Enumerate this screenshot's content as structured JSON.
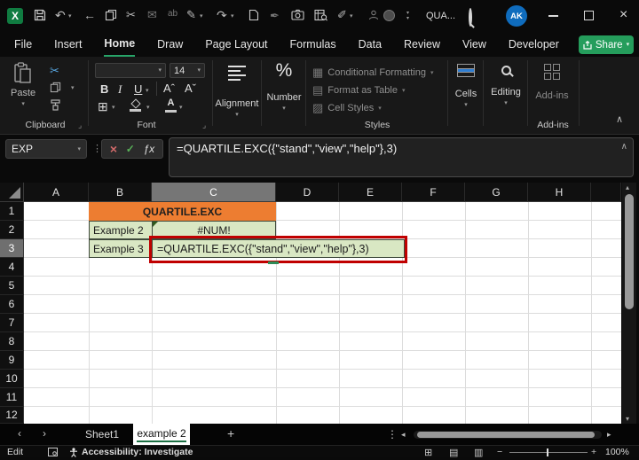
{
  "titlebar": {
    "logo_letter": "X",
    "search_text": "QUA...",
    "avatar_initials": "AK",
    "rename_label": "ab"
  },
  "menu": {
    "items": [
      "File",
      "Insert",
      "Home",
      "Draw",
      "Page Layout",
      "Formulas",
      "Data",
      "Review",
      "View",
      "Developer",
      "Help"
    ],
    "share_label": "Share"
  },
  "ribbon": {
    "clipboard_label": "Clipboard",
    "paste_label": "Paste",
    "font_label": "Font",
    "font_size": "14",
    "bold": "B",
    "italic": "I",
    "underline": "U",
    "grow_font": "Aˆ",
    "shrink_font": "Aˇ",
    "borders_glyph": "⊞",
    "font_color_glyph": "A",
    "alignment_label": "Alignment",
    "number_label": "Number",
    "number_symbol": "%",
    "styles_label": "Styles",
    "conditional_formatting": "Conditional Formatting",
    "format_as_table": "Format as Table",
    "cell_styles": "Cell Styles",
    "cf_glyph": "▦",
    "fat_glyph": "▤",
    "cs_glyph": "▨",
    "cells_label": "Cells",
    "editing_label": "Editing",
    "addins_button": "Add-ins",
    "addins_label": "Add-ins"
  },
  "formula_bar": {
    "name_box": "EXP",
    "cancel_glyph": "×",
    "enter_glyph": "✓",
    "fx": "ƒx",
    "formula": "=QUARTILE.EXC({\"stand\",\"view\",\"help\"},3)"
  },
  "grid": {
    "columns": [
      "A",
      "B",
      "C",
      "D",
      "E",
      "F",
      "G",
      "H"
    ],
    "rows": [
      "1",
      "2",
      "3",
      "4",
      "5",
      "6",
      "7",
      "8",
      "9",
      "10",
      "11",
      "12"
    ],
    "title_cell": "QUARTILE.EXC",
    "example2_label": "Example 2",
    "example2_value": "#NUM!",
    "example3_label": "Example 3",
    "example3_formula": "=QUARTILE.EXC({\"stand\",\"view\",\"help\"},3)"
  },
  "sheet_tabs": {
    "tab1": "Sheet1",
    "tab2": "example 2",
    "add_glyph": "+"
  },
  "status_bar": {
    "mode": "Edit",
    "accessibility": "Accessibility: Investigate",
    "zoom_level": "100%"
  },
  "colors": {
    "accent_green": "#217346",
    "share_green": "#259d5c",
    "title_fill": "#ed7d31",
    "example_fill": "#d9e7c3",
    "annotation_red": "#c00000",
    "avatar_blue": "#0f6cbd"
  }
}
